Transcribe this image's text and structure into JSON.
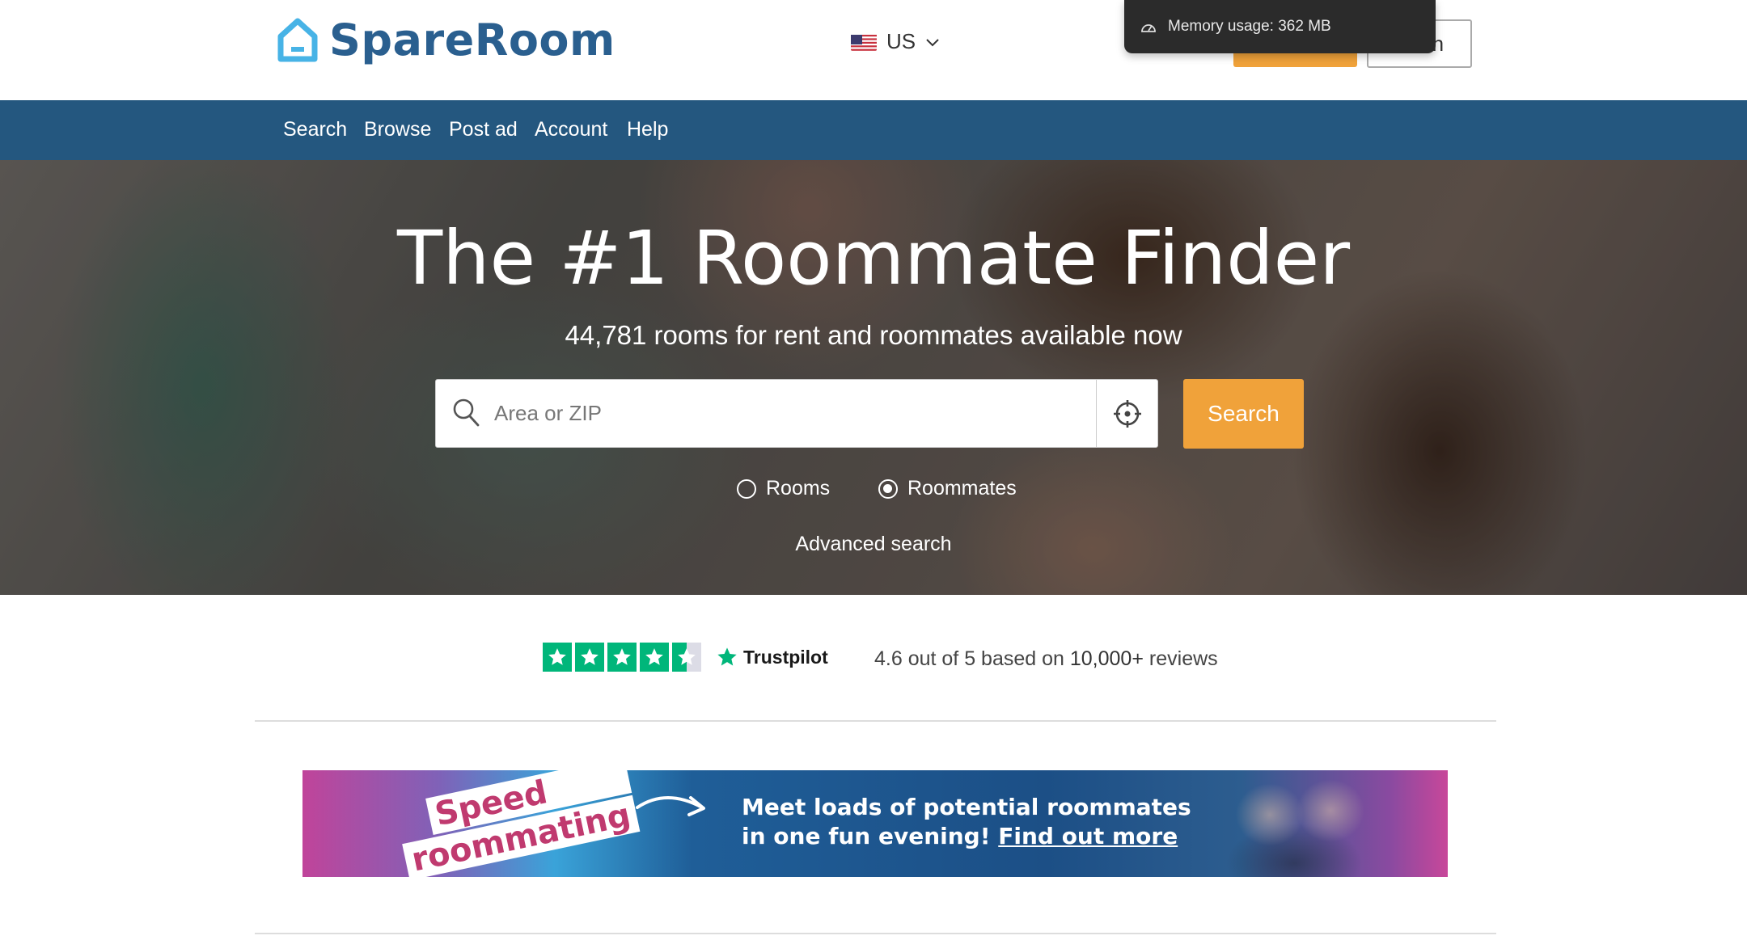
{
  "header": {
    "logo_text": "SpareRoom",
    "country_code": "US",
    "login_button_label": "Log in",
    "memory_tooltip": "Memory usage: 362 MB"
  },
  "nav": {
    "items": [
      "Search",
      "Browse",
      "Post ad",
      "Account",
      "Help"
    ]
  },
  "hero": {
    "title": "The #1 Roommate Finder",
    "subtitle": "44,781 rooms for rent and roommates available now",
    "search_placeholder": "Area or ZIP",
    "search_value": "",
    "search_button": "Search",
    "radio_rooms": "Rooms",
    "radio_roommates": "Roommates",
    "radio_selected": "Roommates",
    "advanced_search": "Advanced search"
  },
  "trust": {
    "brand": "Trustpilot",
    "rating_text": "4.6 out of 5 based on",
    "review_count": "10,000+",
    "reviews_suffix": "reviews",
    "star_rating": 4.5,
    "star_color": "#00b67a"
  },
  "banner": {
    "tag_line1": "Speed",
    "tag_line2": "roommating",
    "text_line1": "Meet loads of potential roommates",
    "text_line2_prefix": "in one fun evening!",
    "link_text": "Find out more"
  },
  "colors": {
    "brand_blue": "#24577f",
    "accent_orange": "#f0a23a",
    "logo_blue": "#2a5f8f"
  }
}
